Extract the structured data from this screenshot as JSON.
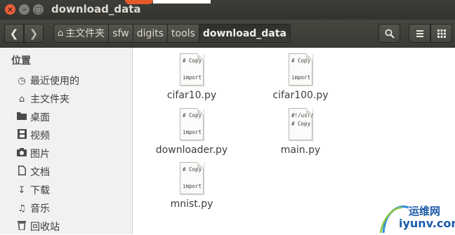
{
  "window": {
    "title": "download_data"
  },
  "toolbar": {
    "back_icon": "chevron-left",
    "forward_icon": "chevron-right",
    "breadcrumbs": [
      "主文件夹",
      "sfw",
      "digits",
      "tools",
      "download_data"
    ],
    "search_icon": "search",
    "list_view_icon": "list",
    "grid_view_icon": "grid"
  },
  "sidebar": {
    "heading": "位置",
    "items": [
      {
        "label": "最近使用的",
        "icon": "clock"
      },
      {
        "label": "主文件夹",
        "icon": "home"
      },
      {
        "label": "桌面",
        "icon": "folder"
      },
      {
        "label": "视频",
        "icon": "film"
      },
      {
        "label": "图片",
        "icon": "camera"
      },
      {
        "label": "文档",
        "icon": "document"
      },
      {
        "label": "下载",
        "icon": "download"
      },
      {
        "label": "音乐",
        "icon": "music"
      },
      {
        "label": "回收站",
        "icon": "trash"
      }
    ]
  },
  "files": [
    {
      "name": "cifar10.py",
      "preview": [
        "# Copy",
        "import"
      ]
    },
    {
      "name": "cifar100.py",
      "preview": [
        "# Copy",
        "import"
      ]
    },
    {
      "name": "downloader.py",
      "preview": [
        "# Copy",
        "import"
      ]
    },
    {
      "name": "main.py",
      "preview": [
        "#!/usr/",
        "# Copy"
      ]
    },
    {
      "name": "mnist.py",
      "preview": [
        "# Copy",
        "import"
      ]
    }
  ],
  "watermark": {
    "site_cn": "运维网",
    "url": "iyunv.com"
  },
  "colors": {
    "titlebar": "#3d3d39",
    "close_button": "#e9613a",
    "sidebar_bg": "#f2f1f0"
  }
}
